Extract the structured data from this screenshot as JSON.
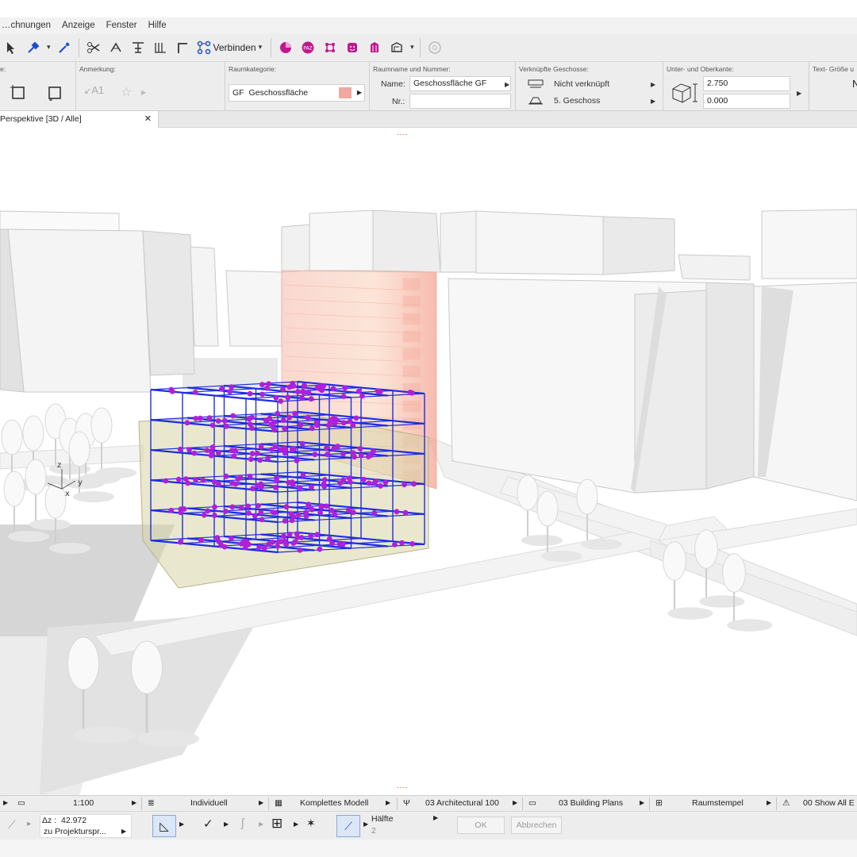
{
  "menu": [
    "…chnungen",
    "Anzeige",
    "Fenster",
    "Hilfe"
  ],
  "toolbar": {
    "connect_label": "Verbinden"
  },
  "infobox": {
    "annotation_head": "Anmerkung:",
    "annotation_text": "A1",
    "category_head": "Raumkategorie:",
    "category_code": "GF",
    "category_name": "Geschossfläche",
    "category_color": "#f0a8a0",
    "name_head": "Raumname und Nummer:",
    "name_label": "Name:",
    "name_value": "Geschossfläche GF",
    "number_label": "Nr.:",
    "number_value": "",
    "linked_head": "Verknüpfte Geschosse:",
    "linked_top": "Nicht verknüpft",
    "linked_bottom": "5. Geschoss",
    "edge_head": "Unter- und Oberkante:",
    "edge_top": "2.750",
    "edge_bottom": "0.000",
    "text_head": "Text- Größe u"
  },
  "tab": {
    "label": "Perspektive [3D / Alle]",
    "close": "✕"
  },
  "statusbar": {
    "scale": "1:100",
    "layer": "Individuell",
    "model": "Komplettes Modell",
    "pen": "03 Architectural 100",
    "plans": "03 Building Plans",
    "stamp": "Raumstempel",
    "show": "00 Show All E"
  },
  "bottombar": {
    "delta_label": "Δz :",
    "delta_value": "42.972",
    "reference": "zu Projekturspr...",
    "half_label": "Hälfte",
    "half_value": "2",
    "ok": "OK",
    "cancel": "Abbrechen"
  },
  "axes": {
    "z": "z",
    "y": "y",
    "x": "x"
  },
  "colors": {
    "highlight": "#f4a998",
    "grid_line": "#1e2ee0",
    "node": "#b020d8",
    "slab": "#c9c48a"
  }
}
